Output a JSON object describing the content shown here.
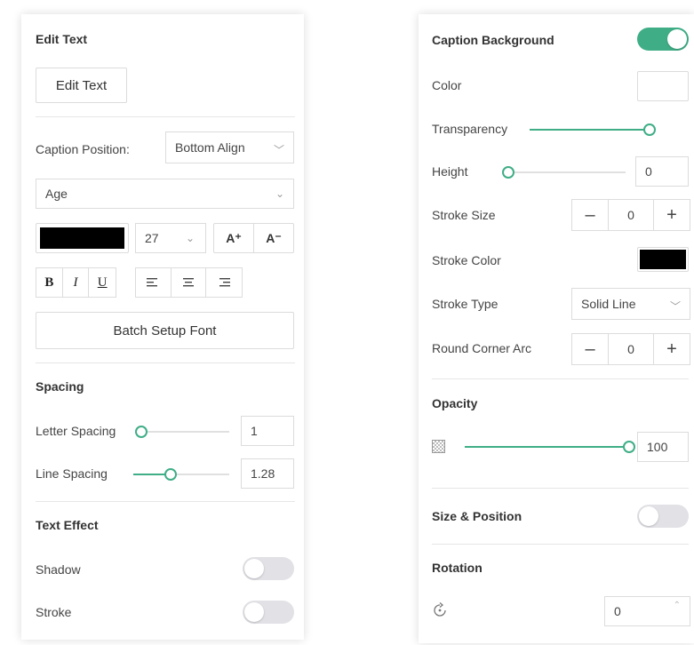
{
  "left_panel": {
    "edit_text_title": "Edit Text",
    "edit_text_button": "Edit Text",
    "caption_position_label": "Caption Position:",
    "caption_position_value": "Bottom Align",
    "font_family_value": "Age",
    "font_color": "#000000",
    "font_size_value": "27",
    "increase_font_label": "A⁺",
    "decrease_font_label": "A⁻",
    "bold_label": "B",
    "italic_label": "I",
    "underline_label": "U",
    "batch_setup_font": "Batch Setup Font",
    "spacing_title": "Spacing",
    "letter_spacing_label": "Letter Spacing",
    "letter_spacing_value": "1",
    "line_spacing_label": "Line Spacing",
    "line_spacing_value": "1.28",
    "text_effect_title": "Text Effect",
    "shadow_label": "Shadow",
    "stroke_label": "Stroke",
    "shadow_on": false,
    "stroke_on": false
  },
  "right_panel": {
    "caption_background_title": "Caption Background",
    "caption_background_on": true,
    "color_label": "Color",
    "color_value": "#ffffff",
    "transparency_label": "Transparency",
    "height_label": "Height",
    "height_value": "0",
    "stroke_size_label": "Stroke Size",
    "stroke_size_value": "0",
    "stroke_color_label": "Stroke Color",
    "stroke_color_value": "#000000",
    "stroke_type_label": "Stroke Type",
    "stroke_type_value": "Solid Line",
    "round_corner_label": "Round Corner Arc",
    "round_corner_value": "0",
    "minus_label": "–",
    "plus_label": "+",
    "opacity_title": "Opacity",
    "opacity_value": "100",
    "size_position_title": "Size & Position",
    "size_position_on": false,
    "rotation_title": "Rotation",
    "rotation_value": "0"
  },
  "accent_color": "#3fae86"
}
